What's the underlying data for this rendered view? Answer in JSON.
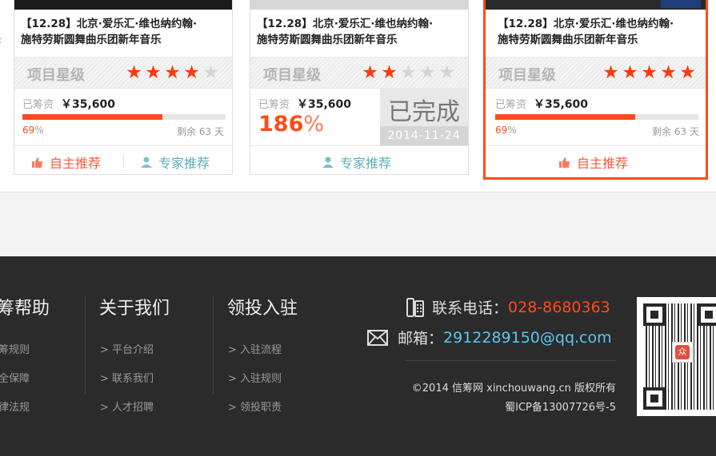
{
  "cards": [
    {
      "title_line1": "【12.28】北京·爱乐汇·维也纳约翰·",
      "title_line2": "施特劳斯圆舞曲乐团新年音乐",
      "rating_label": "项目星级",
      "stars": 4,
      "raised_label": "已筹资",
      "raised_amount": "￥35,600",
      "progress_percent": 69,
      "percent_value": "69",
      "percent_unit": "%",
      "remaining_label": "剩余",
      "remaining_days": "63",
      "days_unit": "天",
      "self_recommend": "自主推荐",
      "expert_recommend": "专家推荐"
    },
    {
      "title_line1": "【12.28】北京·爱乐汇·维也纳约翰·",
      "title_line2": "施特劳斯圆舞曲乐团新年音乐",
      "rating_label": "项目星级",
      "stars": 2,
      "raised_label": "已筹资",
      "raised_amount": "￥35,600",
      "percent_value": "186",
      "percent_unit": "%",
      "status_text": "已完成",
      "status_date": "2014-11-24",
      "expert_recommend": "专家推荐"
    },
    {
      "title_line1": "【12.28】北京·爱乐汇·维也纳约翰·",
      "title_line2": "施特劳斯圆舞曲乐团新年音乐",
      "rating_label": "项目星级",
      "stars": 5,
      "raised_label": "已筹资",
      "raised_amount": "￥35,600",
      "progress_percent": 69,
      "percent_value": "69",
      "percent_unit": "%",
      "remaining_label": "剩余",
      "remaining_days": "63",
      "days_unit": "天",
      "self_recommend": "自主推荐"
    }
  ],
  "footer": {
    "col1": {
      "title": "筹帮助",
      "links": [
        "筹规则",
        "全保障",
        "律法规"
      ]
    },
    "col2": {
      "title": "关于我们",
      "links": [
        "> 平台介绍",
        "> 联系我们",
        "> 人才招聘"
      ]
    },
    "col3": {
      "title": "领投入驻",
      "links": [
        "> 入驻流程",
        "> 入驻规则",
        "> 领投职责"
      ]
    },
    "phone_label": "联系电话：",
    "phone_number": "028-8680363",
    "mail_label": "邮箱：",
    "mail_address": "2912289150@qq.com",
    "copyright": "©2014 信筹网 xinchouwang.cn 版权所有",
    "icp": "蜀ICP备13007726号-5",
    "qr_logo_text": "众"
  },
  "colors": {
    "accent": "#ff4a1c",
    "expert": "#5bb0b8",
    "footer_bg": "#2b2b2b",
    "mail": "#5cc6f0"
  }
}
